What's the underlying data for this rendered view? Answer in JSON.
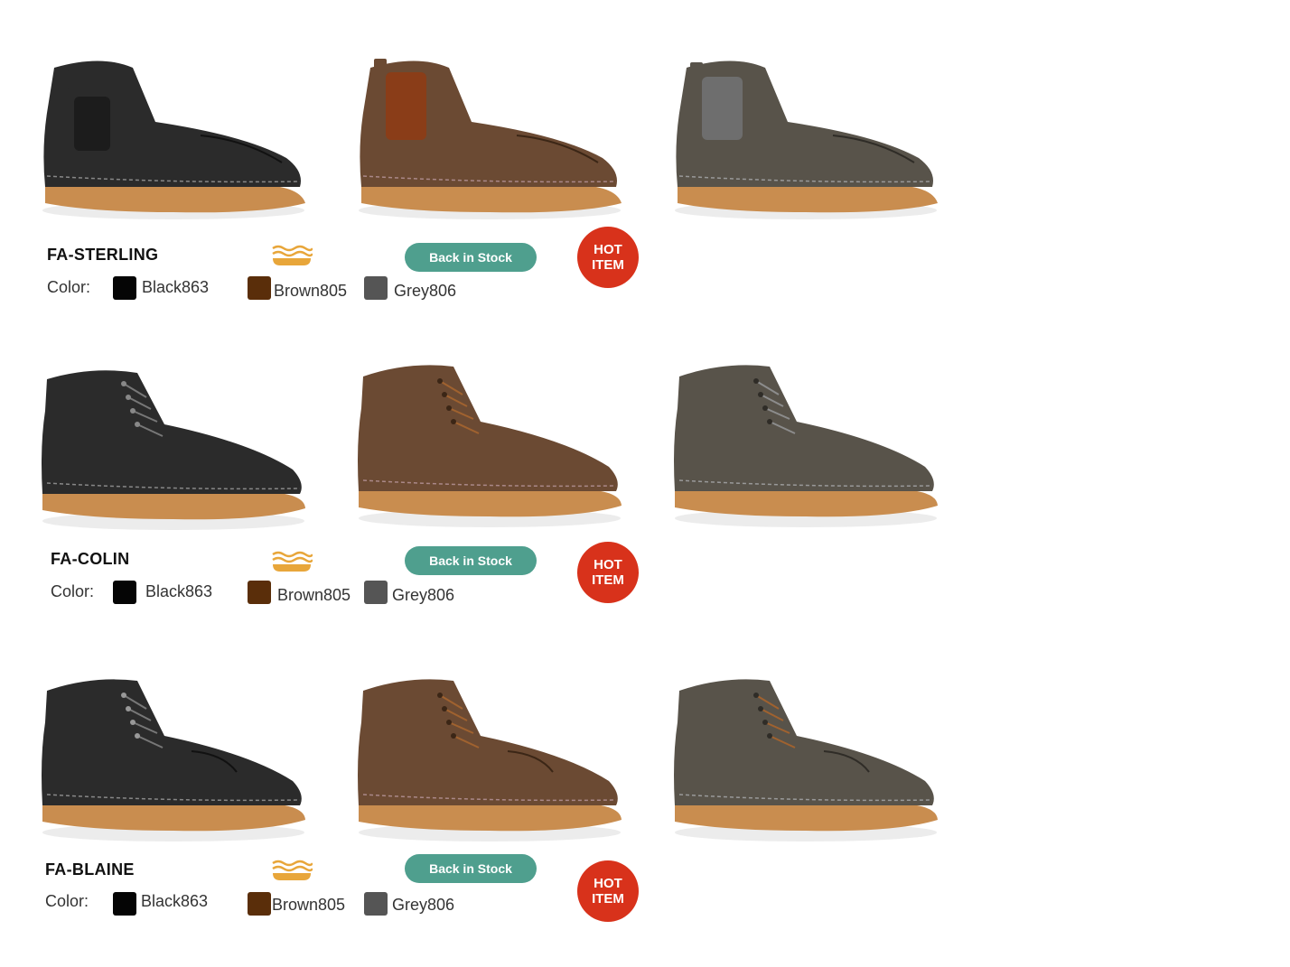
{
  "colors": {
    "accent_button": "#4f9f8e",
    "hot_badge": "#d8321b",
    "wave_icon": "#e8a63a",
    "swatch_black": "#050505",
    "swatch_brown": "#5a2e0a",
    "swatch_grey": "#555555",
    "boot_black": "#2b2b2b",
    "boot_brown": "#6b4a33",
    "boot_grey": "#58534a"
  },
  "icons": {
    "feature": "wave-icon",
    "boot": "boot-image"
  },
  "products": [
    {
      "name": "FA-STERLING",
      "style": "chelsea",
      "color_label": "Color:",
      "stock_label": "Back in Stock",
      "badge_line1": "HOT",
      "badge_line2": "ITEM",
      "swatches": [
        {
          "label": "Black863",
          "color": "#050505"
        },
        {
          "label": "Brown805",
          "color": "#5a2e0a"
        },
        {
          "label": "Grey806",
          "color": "#555555"
        }
      ]
    },
    {
      "name": "FA-COLIN",
      "style": "lace-up",
      "color_label": "Color:",
      "stock_label": "Back in Stock",
      "badge_line1": "HOT",
      "badge_line2": "ITEM",
      "swatches": [
        {
          "label": "Black863",
          "color": "#050505"
        },
        {
          "label": "Brown805",
          "color": "#5a2e0a"
        },
        {
          "label": "Grey806",
          "color": "#555555"
        }
      ]
    },
    {
      "name": "FA-BLAINE",
      "style": "lace-up",
      "color_label": "Color:",
      "stock_label": "Back in Stock",
      "badge_line1": "HOT",
      "badge_line2": "ITEM",
      "swatches": [
        {
          "label": "Black863",
          "color": "#050505"
        },
        {
          "label": "Brown805",
          "color": "#5a2e0a"
        },
        {
          "label": "Grey806",
          "color": "#555555"
        }
      ]
    }
  ]
}
